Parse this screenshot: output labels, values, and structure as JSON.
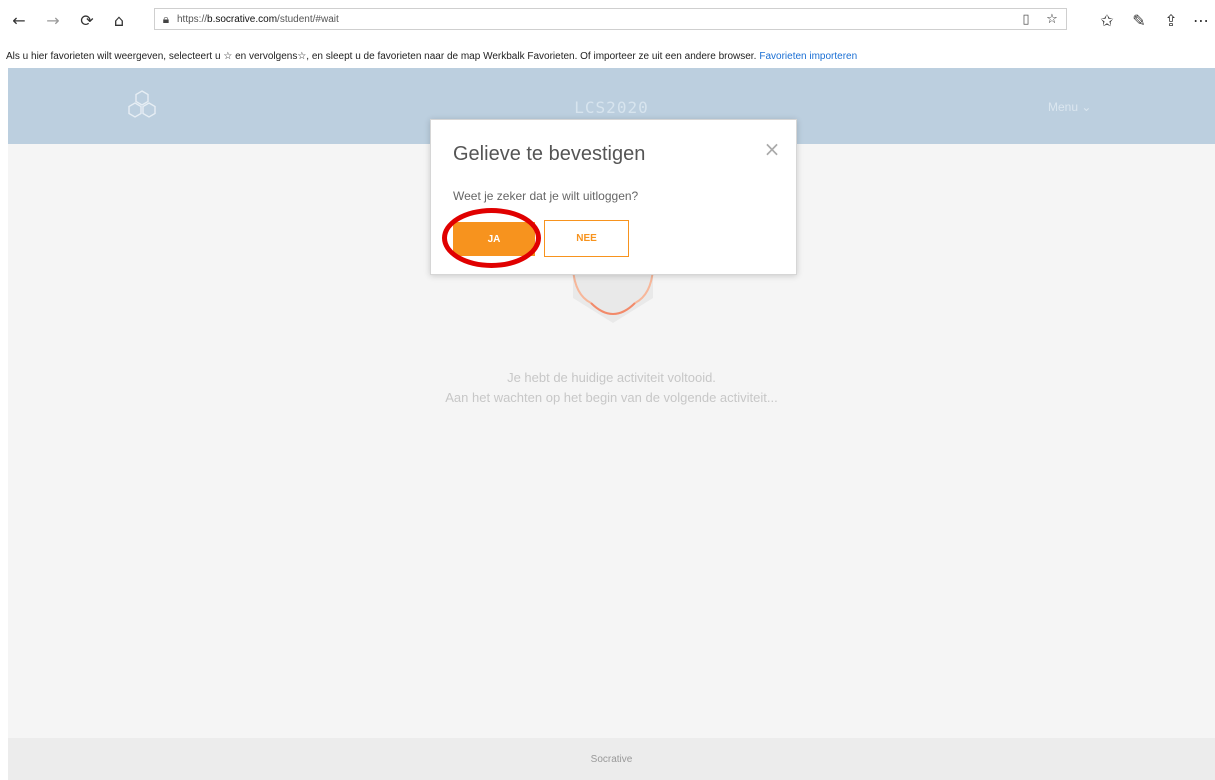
{
  "browser": {
    "back_icon": "arrow-left-icon",
    "forward_icon": "arrow-right-icon",
    "refresh_icon": "refresh-icon",
    "home_icon": "home-icon",
    "lock_icon": "lock-icon",
    "url_prefix": "https://",
    "url_host": "b.socrative.com",
    "url_path": "/student/#wait",
    "favbar": {
      "text": "Als u hier favorieten wilt weergeven, selecteert u ☆ en vervolgens☆, en sleept u de favorieten naar de map Werkbalk Favorieten. Of importeer ze uit een andere browser.",
      "link": "Favorieten importeren"
    }
  },
  "header": {
    "title": "LCS2020",
    "menu": "Menu ⌄",
    "color": "#bccfdf"
  },
  "main": {
    "line1": "Je hebt de huidige activiteit voltooid.",
    "line2": "Aan het wachten op het begin van de volgende activiteit..."
  },
  "footer": {
    "text": "Socrative"
  },
  "modal": {
    "title": "Gelieve te bevestigen",
    "message": "Weet je zeker dat je wilt uitloggen?",
    "yes_label": "JA",
    "no_label": "NEE",
    "accent": "#f7931e"
  },
  "annotation": {
    "color": "#e00000"
  }
}
